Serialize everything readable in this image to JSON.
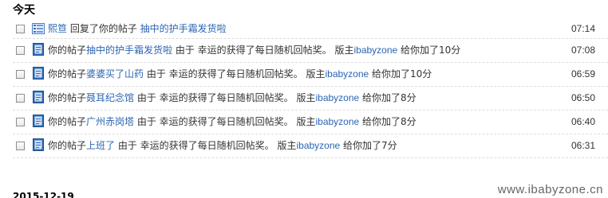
{
  "header": {
    "title": "今天"
  },
  "footer_date": "2015-12-19",
  "watermark": "www.ibabyzone.cn",
  "notifications": [
    {
      "icon": "reply-icon",
      "segments": [
        {
          "t": "熙笪",
          "cls": "link"
        },
        {
          "t": " 回复了你的帖子 ",
          "cls": ""
        },
        {
          "t": "抽中的护手霜发货啦",
          "cls": "link"
        }
      ],
      "time": "07:14"
    },
    {
      "icon": "post-icon",
      "segments": [
        {
          "t": "你的帖子",
          "cls": ""
        },
        {
          "t": "抽中的护手霜发货啦",
          "cls": "link"
        },
        {
          "t": " 由于 幸运的获得了每日随机回帖奖。 版主",
          "cls": ""
        },
        {
          "t": "ibabyzone",
          "cls": "user"
        },
        {
          "t": " 给你加了10分",
          "cls": ""
        }
      ],
      "time": "07:08"
    },
    {
      "icon": "post-icon",
      "segments": [
        {
          "t": "你的帖子",
          "cls": ""
        },
        {
          "t": "婆婆买了山药",
          "cls": "link"
        },
        {
          "t": " 由于 幸运的获得了每日随机回帖奖。 版主",
          "cls": ""
        },
        {
          "t": "ibabyzone",
          "cls": "user"
        },
        {
          "t": " 给你加了10分",
          "cls": ""
        }
      ],
      "time": "06:59"
    },
    {
      "icon": "post-icon",
      "segments": [
        {
          "t": "你的帖子",
          "cls": ""
        },
        {
          "t": "聂耳纪念馆",
          "cls": "link"
        },
        {
          "t": " 由于 幸运的获得了每日随机回帖奖。 版主",
          "cls": ""
        },
        {
          "t": "ibabyzone",
          "cls": "user"
        },
        {
          "t": " 给你加了8分",
          "cls": ""
        }
      ],
      "time": "06:50"
    },
    {
      "icon": "post-icon",
      "segments": [
        {
          "t": "你的帖子",
          "cls": ""
        },
        {
          "t": "广州赤岗塔",
          "cls": "link"
        },
        {
          "t": " 由于 幸运的获得了每日随机回帖奖。 版主",
          "cls": ""
        },
        {
          "t": "ibabyzone",
          "cls": "user"
        },
        {
          "t": " 给你加了8分",
          "cls": ""
        }
      ],
      "time": "06:40"
    },
    {
      "icon": "post-icon",
      "segments": [
        {
          "t": "你的帖子",
          "cls": ""
        },
        {
          "t": "上班了",
          "cls": "link"
        },
        {
          "t": " 由于 幸运的获得了每日随机回帖奖。 版主",
          "cls": ""
        },
        {
          "t": "ibabyzone",
          "cls": "user"
        },
        {
          "t": " 给你加了7分",
          "cls": ""
        }
      ],
      "time": "06:31"
    }
  ]
}
